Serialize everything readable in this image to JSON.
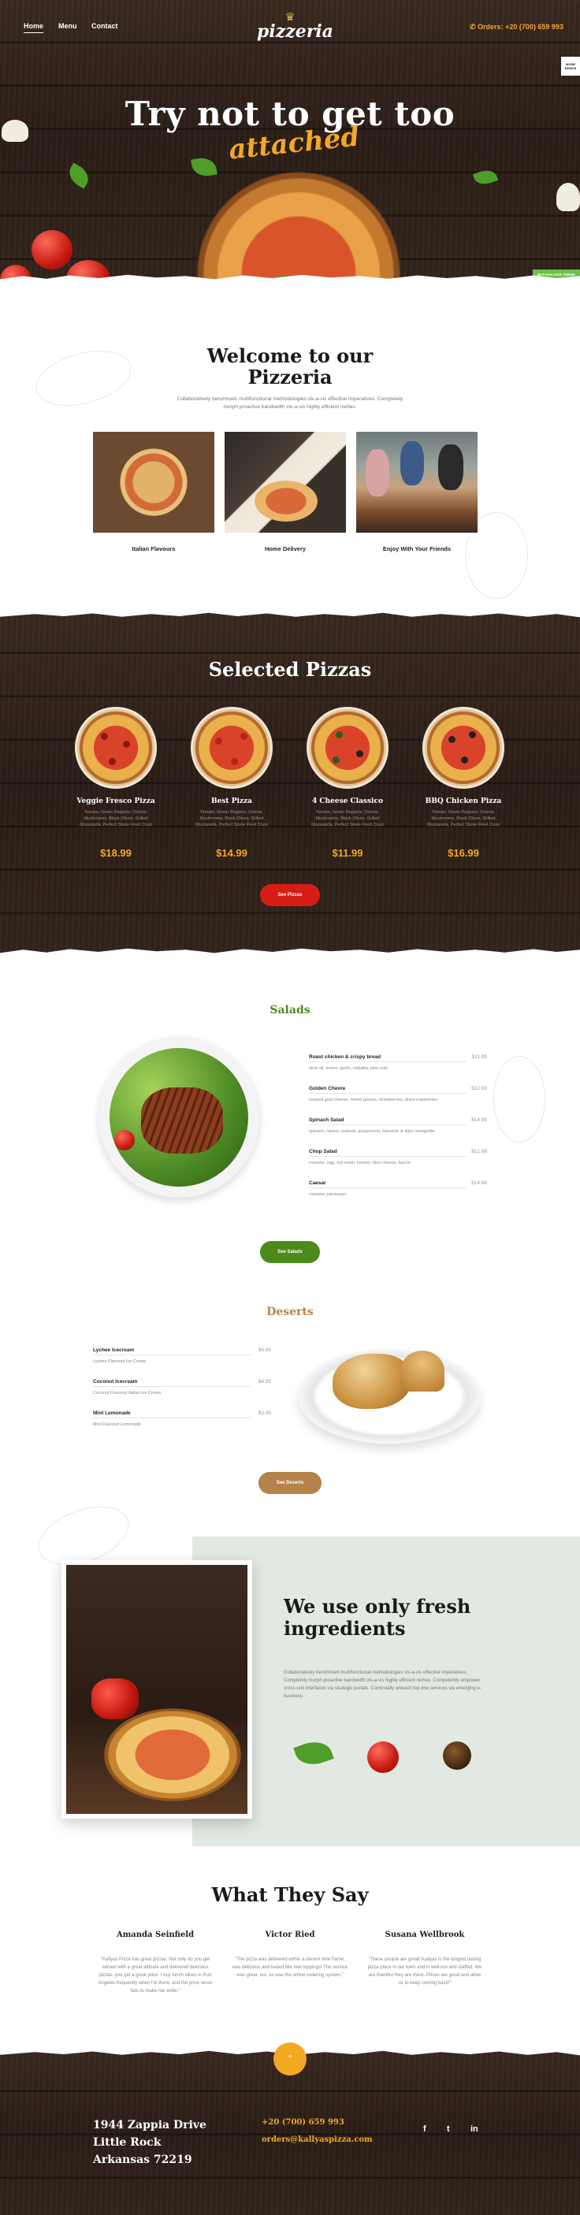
{
  "nav": {
    "items": [
      {
        "label": "Home",
        "active": true
      },
      {
        "label": "Menu"
      },
      {
        "label": "Contact"
      }
    ],
    "logo": "pizzeria",
    "phone": "Orders: +20 (700) 659 993"
  },
  "hero": {
    "title": "Try not to get too",
    "script": "attached",
    "side_badge": "MORE DEMOS",
    "tag": "BUY KALLYAS THEME"
  },
  "welcome": {
    "title_line1": "Welcome to our",
    "title_line2": "Pizzeria",
    "text": "Collaboratively benchmark multifunctional methodologies vis-a-vis effective imperatives. Completely morph proactive bandwidth vis-a-vis highly efficient niches.",
    "features": [
      {
        "caption": "Italian Flavours"
      },
      {
        "caption": "Home Delivery"
      },
      {
        "caption": "Enjoy With Your Friends"
      }
    ]
  },
  "pizzas": {
    "title": "Selected Pizzas",
    "items": [
      {
        "name": "Veggie Fresco Pizza",
        "desc": "Tomato, Green Peppers, Onions, Mushrooms, Black Olives, Grilled Mozzarella, Perfect Stone Fired Crust",
        "price": "$18.99"
      },
      {
        "name": "Best Pizza",
        "desc": "Tomato, Green Peppers, Onions, Mushrooms, Black Olives, Grilled Mozzarella, Perfect Stone Fired Crust",
        "price": "$14.99"
      },
      {
        "name": "4 Cheese Classico",
        "desc": "Tomato, Green Peppers, Onions, Mushrooms, Black Olives, Grilled Mozzarella, Perfect Stone Fired Crust",
        "price": "$11.99"
      },
      {
        "name": "BBQ Chicken Pizza",
        "desc": "Tomato, Green Peppers, Onions, Mushrooms, Black Olives, Grilled Mozzarella, Perfect Stone Fired Crust",
        "price": "$16.99"
      }
    ],
    "button": "See Pizzas"
  },
  "salads": {
    "title": "Salads",
    "items": [
      {
        "name": "Roast chicken & crispy bread",
        "price": "$11.99",
        "desc": "olive oil, lemon, garlic, ciabatta, pine nuts"
      },
      {
        "name": "Golden Chevre",
        "price": "$12.99",
        "desc": "toasted goat cheese, mixed greens, strawberries, dried cranberries"
      },
      {
        "name": "Spinach Salad",
        "price": "$14.99",
        "desc": "spinach, raisins, walnuts, gorgonzola, balsamic & dijon vinaigrette"
      },
      {
        "name": "Chop Salad",
        "price": "$12.99",
        "desc": "romaine, egg, red onion, tomato, bleu cheese, bacon"
      },
      {
        "name": "Caesar",
        "price": "$14.99",
        "desc": "romaine, parmesan"
      }
    ],
    "button": "See Salads"
  },
  "deserts": {
    "title": "Deserts",
    "items": [
      {
        "name": "Lychee Icecream",
        "price": "$6.99",
        "desc": "Lychee Flavored Ice Cream"
      },
      {
        "name": "Coconut Icecream",
        "price": "$4.99",
        "desc": "Coconut Flavored Italian Ice Cream"
      },
      {
        "name": "Mint Lemonade",
        "price": "$3.99",
        "desc": "Mint Flavored Lemonade"
      }
    ],
    "button": "See Deserts"
  },
  "ingredients": {
    "title_line1": "We use only fresh",
    "title_line2": "ingredients",
    "text": "Collaboratively benchmark multifunctional methodologies vis-a-vis effective imperatives. Completely morph proactive bandwidth vis-a-vis highly efficient niches. Competently empower cross-unit interfaces via strategic portals. Continually unleash top-line services via emerging e-business."
  },
  "testimonials": {
    "title": "What They Say",
    "items": [
      {
        "name": "Amanda Seinfield",
        "text": "\"Kallyas Pizza has great pizzas. Not only do you get served with a great attitude and delivered delicious pizzas, you get a great price. I buy lunch slices in Port Angeles frequently when I'm there, and the price never fails to make me smile.\""
      },
      {
        "name": "Victor Ried",
        "text": "\"The pizza was delivered within a decent time frame, was delicious and tasted like real toppings! The service was great, too, as was the online ordering system.\""
      },
      {
        "name": "Susana Wellbrook",
        "text": "\"These people are great! Kallyas is the longest lasting pizza place in our town and is well-run and staffed. We are thankful they are there. Prices are great and allow us to keep coming back!\""
      }
    ]
  },
  "footer": {
    "address_line1": "1944 Zappia Drive",
    "address_line2": "Little Rock",
    "address_line3": "Arkansas 72219",
    "phone": "+20 (700) 659 993",
    "email": "orders@kallyaspizza.com",
    "social": [
      {
        "label": "f",
        "icon": "facebook-icon"
      },
      {
        "label": "t",
        "icon": "twitter-icon"
      },
      {
        "label": "in",
        "icon": "linkedin-icon"
      }
    ],
    "scroll_top": "⌃"
  }
}
